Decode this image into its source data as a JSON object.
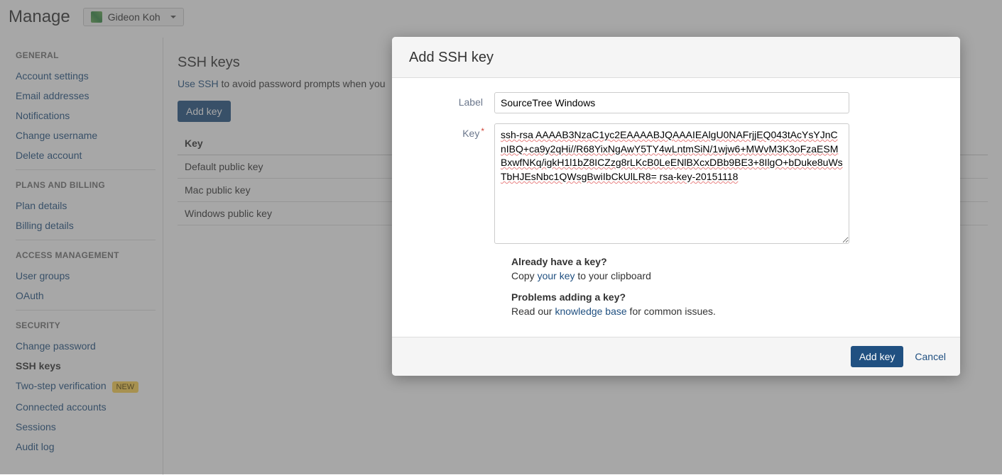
{
  "header": {
    "title": "Manage",
    "user_name": "Gideon Koh"
  },
  "sidebar": {
    "sections": {
      "general": {
        "title": "GENERAL",
        "items": [
          "Account settings",
          "Email addresses",
          "Notifications",
          "Change username",
          "Delete account"
        ]
      },
      "plans": {
        "title": "PLANS AND BILLING",
        "items": [
          "Plan details",
          "Billing details"
        ]
      },
      "access": {
        "title": "ACCESS MANAGEMENT",
        "items": [
          "User groups",
          "OAuth"
        ]
      },
      "security": {
        "title": "SECURITY",
        "items": [
          "Change password",
          "SSH keys",
          "Two-step verification",
          "Connected accounts",
          "Sessions",
          "Audit log"
        ],
        "new_badge": "NEW"
      }
    }
  },
  "main": {
    "heading": "SSH keys",
    "desc_link": "Use SSH",
    "desc_rest": " to avoid password prompts when you",
    "add_key_btn": "Add key",
    "table_header": "Key",
    "rows": [
      "Default public key",
      "Mac public key",
      "Windows public key"
    ]
  },
  "modal": {
    "title": "Add SSH key",
    "label_label": "Label",
    "label_value": "SourceTree Windows",
    "key_label": "Key",
    "key_value": "ssh-rsa AAAAB3NzaC1yc2EAAAABJQAAAIEAlgU0NAFrjjEQ043tAcYsYJnCnIBQ+ca9y2qHi//R68YixNgAwY5TY4wLntmSiN/1wjw6+MWvM3K3oFzaESMBxwfNKq/igkH1l1bZ8ICZzg8rLKcB0LeENlBXcxDBb9BE3+8IlgO+bDuke8uWsTbHJEsNbc1QWsgBwiIbCkUlLR8= rsa-key-20151118",
    "help": {
      "have_key_q": "Already have a key?",
      "have_key_pre": "Copy ",
      "have_key_link": "your key",
      "have_key_post": " to your clipboard",
      "problems_q": "Problems adding a key?",
      "problems_pre": "Read our ",
      "problems_link": "knowledge base",
      "problems_post": " for common issues."
    },
    "footer": {
      "add": "Add key",
      "cancel": "Cancel"
    }
  }
}
